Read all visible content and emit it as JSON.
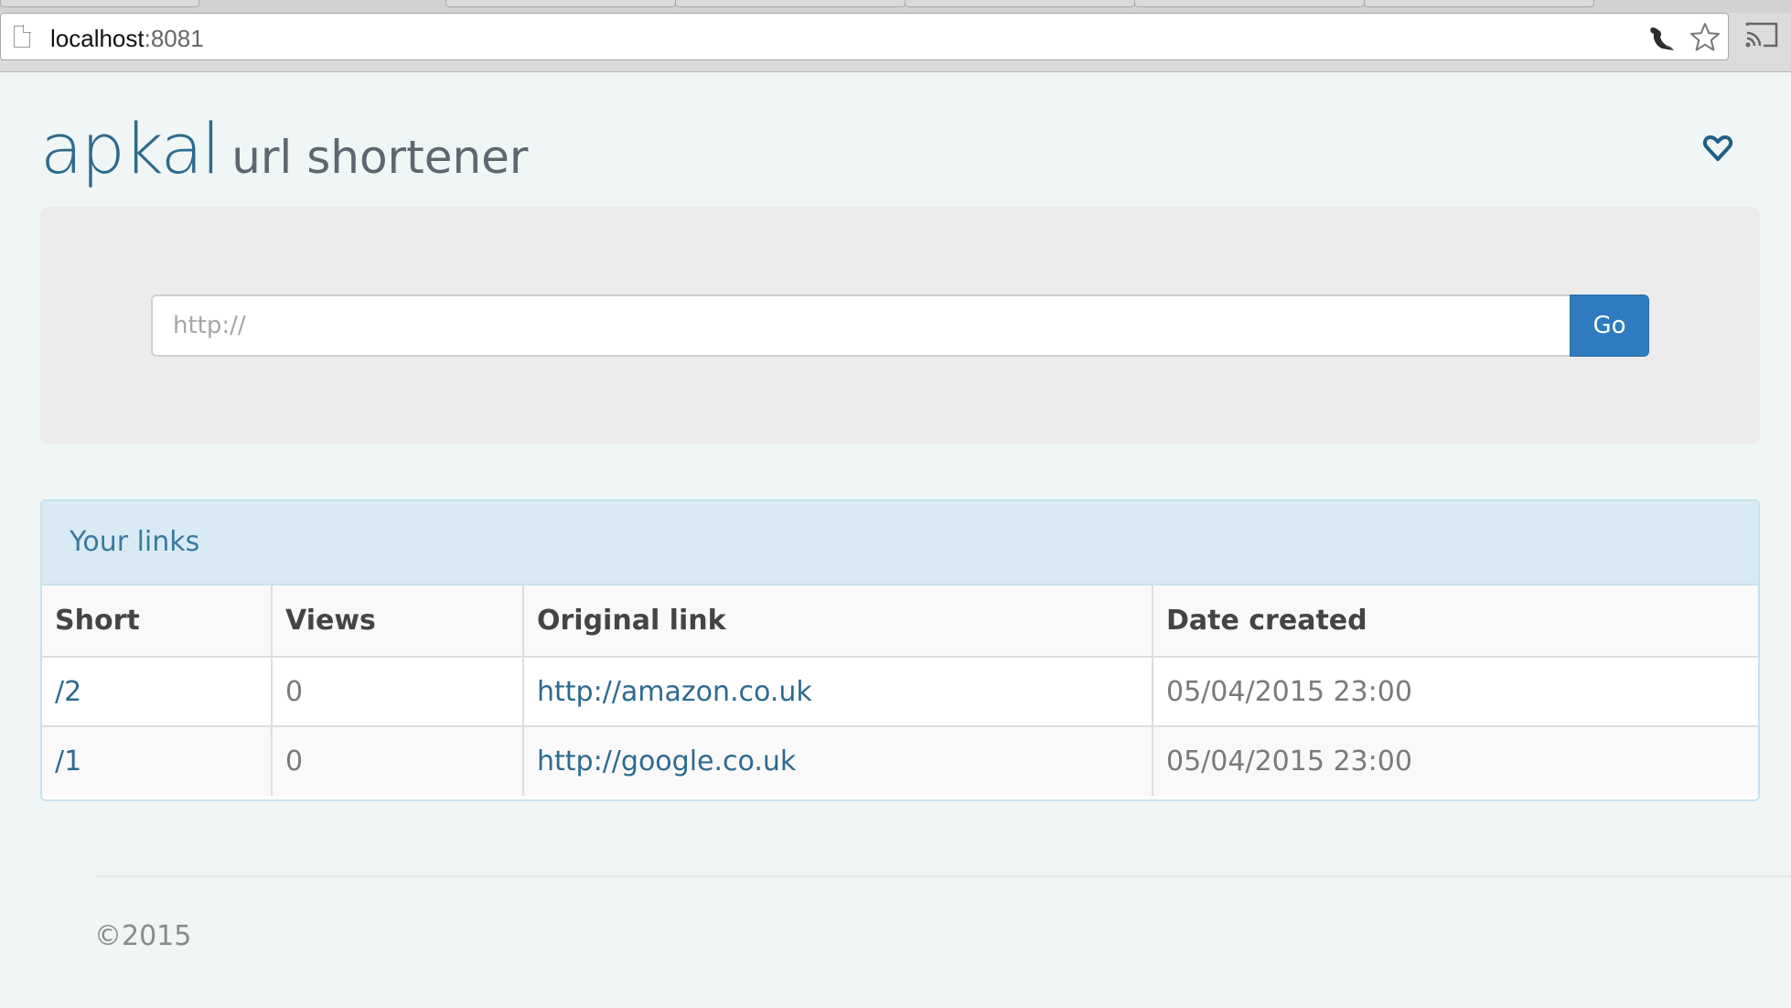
{
  "browser": {
    "url_host": "localhost",
    "url_port": ":8081"
  },
  "header": {
    "brand": "apkal",
    "subtitle": "url shortener",
    "icon": "heart-icon"
  },
  "form": {
    "placeholder": "http://",
    "value": "",
    "go_label": "Go"
  },
  "links_panel": {
    "title": "Your links",
    "columns": [
      "Short",
      "Views",
      "Original link",
      "Date created"
    ],
    "rows": [
      {
        "short": "/2",
        "views": "0",
        "original": "http://amazon.co.uk",
        "date": "05/04/2015 23:00"
      },
      {
        "short": "/1",
        "views": "0",
        "original": "http://google.co.uk",
        "date": "05/04/2015 23:00"
      }
    ]
  },
  "footer": {
    "copyright": "©2015"
  },
  "colors": {
    "brand": "#2d6a8f",
    "button": "#2f7bbf",
    "panel_heading": "#d9eaf4",
    "page_bg": "#eff6f5"
  }
}
